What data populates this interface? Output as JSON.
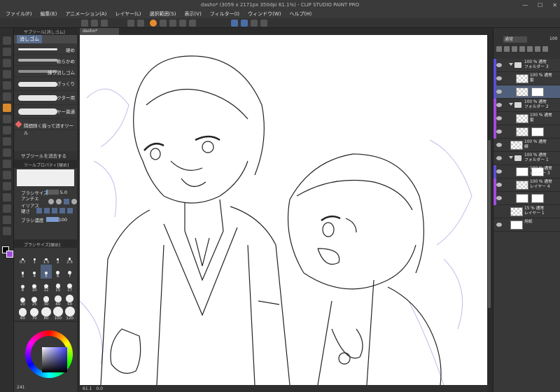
{
  "window": {
    "title": "dasho* (3059 x 2171px 350dpi 61.1%)  - CLIP STUDIO PAINT PRO",
    "controls": [
      "—",
      "☐",
      "✕"
    ]
  },
  "menu": [
    "ファイル(F)",
    "編集(E)",
    "アニメーション(A)",
    "レイヤー(L)",
    "選択範囲(S)",
    "表示(V)",
    "フィルター(I)",
    "ウィンドウ(W)",
    "ヘルプ(H)"
  ],
  "colors": {
    "accent_tool": "#d98a2b",
    "selection_blue": "#50607c",
    "layer_tag_blue": "#5a4ed8",
    "layer_tag_purple": "#a24be0",
    "sub_color": "#a24be0"
  },
  "subtool": {
    "panel_title": "サブツール[消しゴム]",
    "group_tab": "消しゴム",
    "items": [
      {
        "label": "硬め"
      },
      {
        "label": "軟らかめ"
      },
      {
        "label": "練り消しゴム"
      },
      {
        "label": "ざっくり"
      },
      {
        "label": "ベクター用"
      },
      {
        "label": "レイヤー貫通"
      }
    ],
    "extra_item": "隣間隙く描って消すツール",
    "footer": "サブツールを消去する"
  },
  "toolprop": {
    "panel_title": "ツールプロパティ[硬め]",
    "rows": [
      {
        "label": "ブラシサイズ",
        "value": "5.0",
        "fill": 0.1
      },
      {
        "label": "アンチエイリアス",
        "value": ""
      },
      {
        "label": "硬さ",
        "value": ""
      },
      {
        "label": "ブラシ濃度",
        "value": "100",
        "fill": 1.0
      }
    ]
  },
  "brushsize": {
    "panel_title": "ブラシサイズ[硬め]",
    "sizes": [
      "0.7",
      "1",
      "1.5",
      "2",
      "2.5",
      "3",
      "4",
      "5",
      "6",
      "7",
      "8",
      "10",
      "12",
      "15",
      "17",
      "20",
      "25",
      "30",
      "40",
      "50",
      "60",
      "70",
      "80",
      "100",
      "120"
    ],
    "selected_index": 7
  },
  "statusbar": {
    "zoom": "61.1",
    "angle": "0.0",
    "left_status": "241"
  },
  "document": {
    "tab": "dasho*"
  },
  "layers": {
    "blend_mode": "通常",
    "opacity": "100",
    "rows": [
      {
        "name1": "100 % 通常",
        "name2": "フォルダー 3",
        "type": "folder",
        "indent": 0,
        "tag": "blue",
        "selected": false,
        "eye": true
      },
      {
        "name1": "100 % 通常",
        "name2": "髪",
        "type": "layer",
        "indent": 1,
        "tag": "blue",
        "selected": false,
        "eye": true
      },
      {
        "name1": "",
        "name2": "",
        "type": "layer-mask",
        "indent": 1,
        "tag": "blue",
        "selected": true,
        "eye": true
      },
      {
        "name1": "100 % 通常",
        "name2": "フォルダー 2",
        "type": "folder",
        "indent": 0,
        "tag": "purple",
        "selected": false,
        "eye": true
      },
      {
        "name1": "100 % 通常",
        "name2": "髪",
        "type": "layer",
        "indent": 1,
        "tag": "purple",
        "selected": false,
        "eye": true
      },
      {
        "name1": "",
        "name2": "",
        "type": "layer-mask",
        "indent": 1,
        "tag": "purple",
        "selected": false,
        "eye": true
      },
      {
        "name1": "100 % 通常",
        "name2": "線",
        "type": "layer",
        "indent": 0,
        "tag": "none",
        "selected": false,
        "eye": true
      },
      {
        "name1": "100 % 通常",
        "name2": "フォルダー 1",
        "type": "folder",
        "indent": 0,
        "tag": "none",
        "selected": false,
        "eye": true
      },
      {
        "name1": "100 % 通常",
        "name2": "レイヤー 3",
        "type": "art",
        "indent": 1,
        "tag": "blue",
        "selected": false,
        "eye": true
      },
      {
        "name1": "100 % 通常",
        "name2": "レイヤー 4",
        "type": "layer",
        "indent": 1,
        "tag": "purple",
        "selected": false,
        "eye": true
      },
      {
        "name1": "",
        "name2": "",
        "type": "art",
        "indent": 1,
        "tag": "purple",
        "selected": false,
        "eye": true
      },
      {
        "name1": "15 % 通常",
        "name2": "レイヤー 1",
        "type": "sketch",
        "indent": 0,
        "tag": "none",
        "selected": false,
        "eye": false
      },
      {
        "name1": "",
        "name2": "用紙",
        "type": "paper",
        "indent": 0,
        "tag": "none",
        "selected": false,
        "eye": true
      }
    ]
  }
}
